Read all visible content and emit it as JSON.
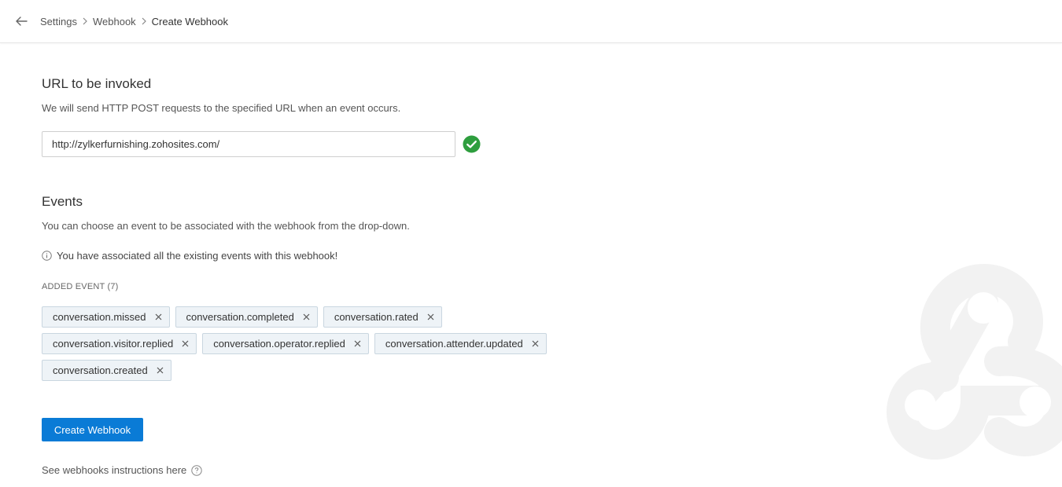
{
  "breadcrumb": {
    "items": [
      "Settings",
      "Webhook"
    ],
    "current": "Create Webhook"
  },
  "url_section": {
    "title": "URL to be invoked",
    "description": "We will send HTTP POST requests to the specified URL when an event occurs.",
    "input_value": "http://zylkerfurnishing.zohosites.com/"
  },
  "events_section": {
    "title": "Events",
    "description": "You can choose an event to be associated with the webhook from the drop-down.",
    "info_message": "You have associated all the existing events with this webhook!",
    "added_label": "ADDED EVENT (7)",
    "tags": [
      "conversation.missed",
      "conversation.completed",
      "conversation.rated",
      "conversation.visitor.replied",
      "conversation.operator.replied",
      "conversation.attender.updated",
      "conversation.created"
    ]
  },
  "actions": {
    "create_label": "Create Webhook",
    "instructions_text": "See webhooks instructions here"
  },
  "icons": {
    "back": "arrow-left-icon",
    "valid": "check-circle-icon",
    "info": "info-icon",
    "tag_close": "close-icon",
    "help": "question-icon",
    "watermark": "webhook-icon"
  },
  "colors": {
    "primary": "#0a7bd6",
    "success": "#2e9e3e",
    "tag_bg": "#eef3f7",
    "tag_border": "#c9d6e0"
  }
}
